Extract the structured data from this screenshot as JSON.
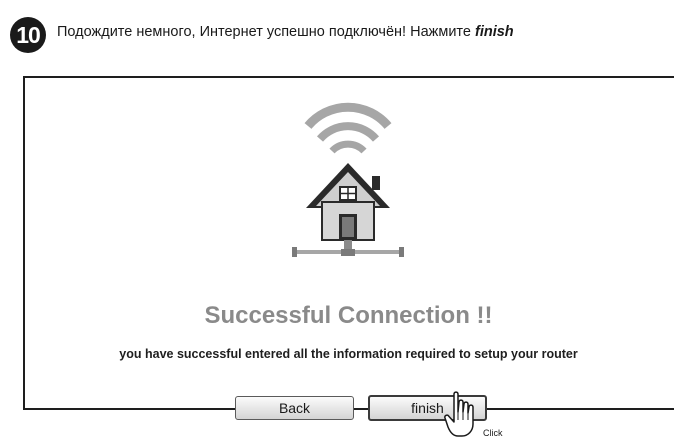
{
  "step": {
    "number": "10"
  },
  "instruction": {
    "text": "Подождите немного, Интернет успешно подключён! Нажмите ",
    "emphasis": "finish"
  },
  "panel": {
    "title": "Successful Connection !!",
    "description": "you have successful entered all the information required to setup your router"
  },
  "buttons": {
    "back": "Back",
    "finish": "finish"
  },
  "cursor": {
    "label": "Click"
  },
  "colors": {
    "title": "#8a8a8a",
    "badge": "#1a1a1a",
    "border": "#1e1e1e"
  },
  "icons": [
    "wifi-signal-icon",
    "house-icon",
    "network-icon",
    "hand-cursor-icon"
  ]
}
